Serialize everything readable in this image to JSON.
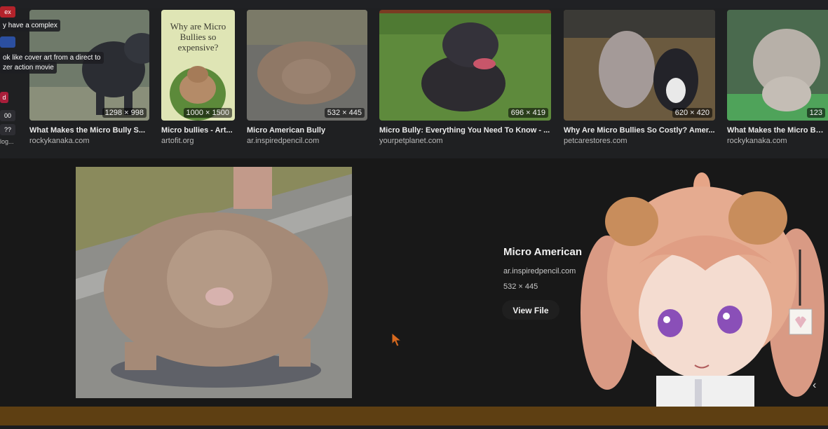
{
  "results": [
    {
      "title": "What Makes the Micro Bully S...",
      "source": "rockykanaka.com",
      "dims": "1298 × 998"
    },
    {
      "title": "Micro bullies - Art...",
      "source": "artofit.org",
      "dims": "1000 × 1500",
      "poster_text": "Why are Micro Bullies so expensive?"
    },
    {
      "title": "Micro American Bully",
      "source": "ar.inspiredpencil.com",
      "dims": "532 × 445"
    },
    {
      "title": "Micro Bully: Everything You Need To Know - ...",
      "source": "yourpetplanet.com",
      "dims": "696 × 419"
    },
    {
      "title": "Why Are Micro Bullies So Costly? Amer...",
      "source": "petcarestores.com",
      "dims": "620 × 420"
    },
    {
      "title": "What Makes the Micro Bully",
      "source": "rockykanaka.com",
      "dims": "123"
    }
  ],
  "chat": {
    "messages": [
      "y have a complex",
      "ok like cover art from a direct to",
      "zer action movie"
    ],
    "side_tags": [
      "ex",
      "00",
      "d",
      "??",
      "log..."
    ]
  },
  "preview": {
    "title": "Micro American",
    "source": "ar.inspiredpencil.com",
    "dims": "532 × 445",
    "view_file": "View File",
    "next_icon": "chevron-right-icon"
  },
  "colors": {
    "background": "#1b1c1e",
    "bottom_bar": "#5e3f12",
    "text": "#e8e8e8"
  }
}
